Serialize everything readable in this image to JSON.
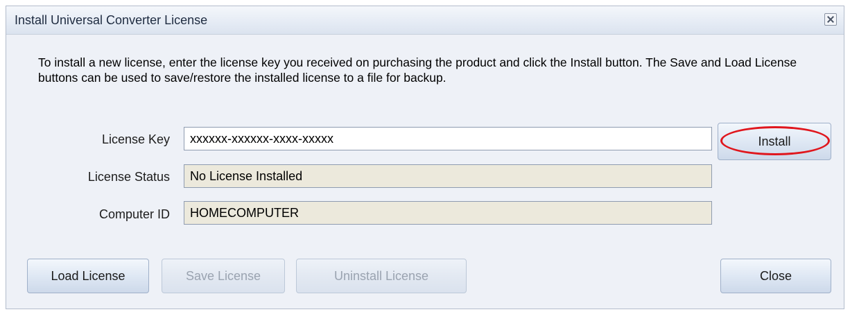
{
  "window": {
    "title": "Install Universal Converter License"
  },
  "description": "To install a new license, enter the license key you received on purchasing the product and click the Install button.  The Save and Load License buttons can be used to save/restore the installed license to a file for backup.",
  "form": {
    "license_key_label": "License Key",
    "license_key_value": "xxxxxx-xxxxxx-xxxx-xxxxx",
    "license_status_label": "License Status",
    "license_status_value": "No License Installed",
    "computer_id_label": "Computer ID",
    "computer_id_value": "HOMECOMPUTER"
  },
  "buttons": {
    "install": "Install",
    "load_license": "Load License",
    "save_license": "Save License",
    "uninstall_license": "Uninstall License",
    "close": "Close"
  },
  "annotation": {
    "highlight_color": "#e0161d"
  }
}
